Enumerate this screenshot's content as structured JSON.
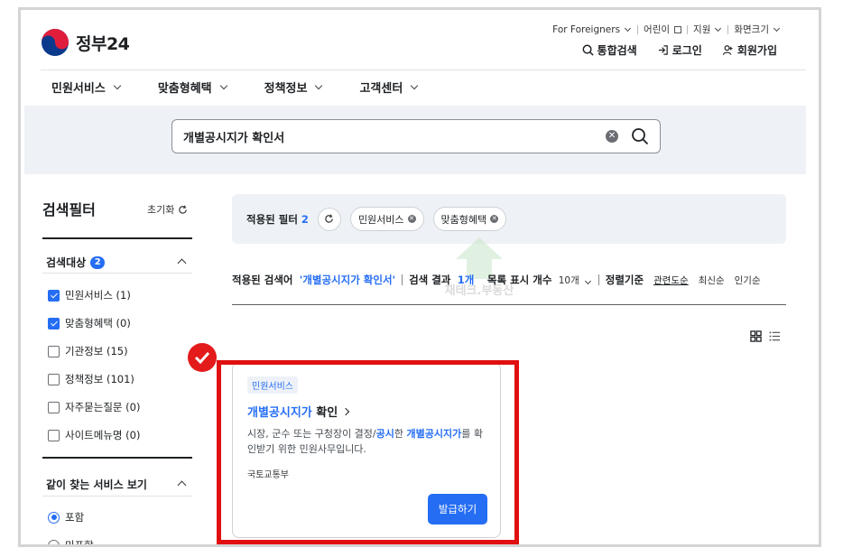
{
  "header": {
    "logo_text": "정부24",
    "util_top": [
      {
        "label": "For Foreigners",
        "has_chevron": true
      },
      {
        "label": "어린이",
        "has_external": true
      },
      {
        "label": "지원",
        "has_chevron": true
      },
      {
        "label": "화면크기",
        "has_chevron": true
      }
    ],
    "util_bottom": {
      "search": "통합검색",
      "login": "로그인",
      "signup": "회원가입"
    }
  },
  "gnb": [
    "민원서비스",
    "맞춤형혜택",
    "정책정보",
    "고객센터"
  ],
  "search": {
    "value": "개별공시지가 확인서"
  },
  "sidebar": {
    "title": "검색필터",
    "reset_label": "초기화",
    "target_section": {
      "title": "검색대상",
      "badge": "2",
      "items": [
        {
          "label": "민원서비스 (1)",
          "checked": true
        },
        {
          "label": "맞춤형혜택 (0)",
          "checked": true
        },
        {
          "label": "기관정보 (15)",
          "checked": false
        },
        {
          "label": "정책정보 (101)",
          "checked": false
        },
        {
          "label": "자주묻는질문 (0)",
          "checked": false
        },
        {
          "label": "사이트메뉴명 (0)",
          "checked": false
        }
      ]
    },
    "together_section": {
      "title": "같이 찾는 서비스 보기",
      "options": [
        {
          "label": "포함",
          "selected": true
        },
        {
          "label": "미포함",
          "selected": false
        }
      ]
    }
  },
  "filters": {
    "label": "적용된 필터",
    "count": "2",
    "chips": [
      "민원서비스",
      "맞춤형혜택"
    ]
  },
  "results": {
    "keyword_label": "적용된 검색어",
    "keyword": "'개별공시지가 확인서'",
    "count_label": "검색 결과",
    "count": "1개",
    "page_size_label": "목록 표시 개수",
    "page_size": "10개",
    "sort_label": "정렬기준",
    "sort_options": [
      "관련도순",
      "최신순",
      "인기순"
    ],
    "sort_selected": "관련도순"
  },
  "watermark": "재테크.부동산",
  "card": {
    "tag": "민원서비스",
    "title_highlight": "개별공시지가",
    "title_rest": " 확인",
    "desc_part1": "시장, 군수 또는 구청장이 결정/",
    "desc_hl1": "공시",
    "desc_part2": "한 ",
    "desc_hl2": "개별공시지가",
    "desc_part3": "를 확인받기 위한 민원사무입니다.",
    "org": "국토교통부",
    "button": "발급하기"
  },
  "colors": {
    "accent": "#256ef4",
    "annotation": "#e01010",
    "band": "#eef1f5"
  }
}
